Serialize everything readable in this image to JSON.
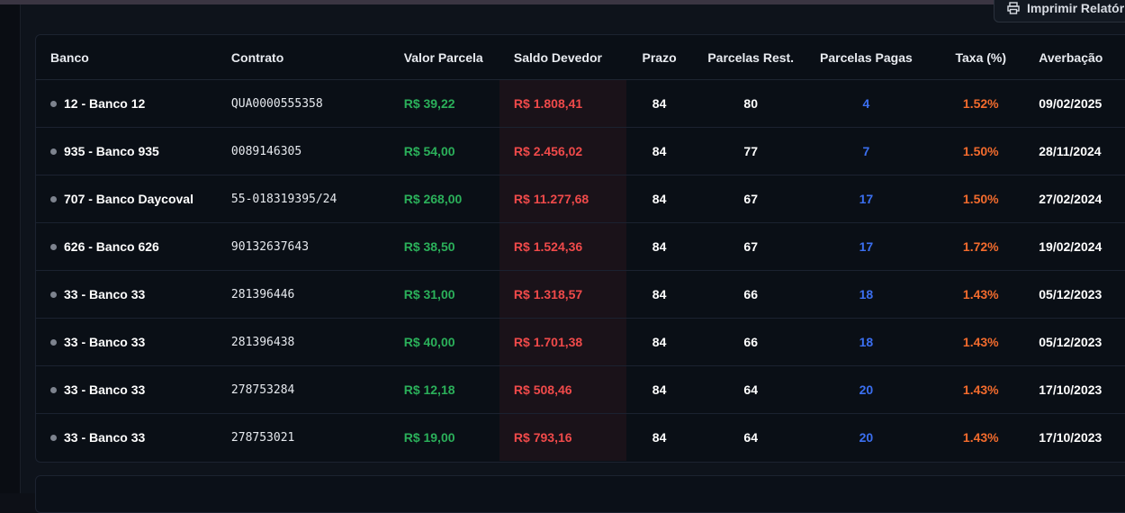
{
  "toolbar": {
    "print_label": "Imprimir Relatório",
    "print_icon": "printer-icon"
  },
  "table": {
    "headers": {
      "banco": "Banco",
      "contrato": "Contrato",
      "valor": "Valor Parcela",
      "saldo": "Saldo Devedor",
      "prazo": "Prazo",
      "rest": "Parcelas Rest.",
      "pagas": "Parcelas Pagas",
      "taxa": "Taxa (%)",
      "aver": "Averbação"
    },
    "rows": [
      {
        "banco": "12 - Banco 12",
        "contrato": "QUA0000555358",
        "valor": "R$ 39,22",
        "saldo": "R$ 1.808,41",
        "prazo": "84",
        "rest": "80",
        "pagas": "4",
        "taxa": "1.52%",
        "aver": "09/02/2025"
      },
      {
        "banco": "935 - Banco 935",
        "contrato": "0089146305",
        "valor": "R$ 54,00",
        "saldo": "R$ 2.456,02",
        "prazo": "84",
        "rest": "77",
        "pagas": "7",
        "taxa": "1.50%",
        "aver": "28/11/2024"
      },
      {
        "banco": "707 - Banco Daycoval",
        "contrato": "55-018319395/24",
        "valor": "R$ 268,00",
        "saldo": "R$ 11.277,68",
        "prazo": "84",
        "rest": "67",
        "pagas": "17",
        "taxa": "1.50%",
        "aver": "27/02/2024"
      },
      {
        "banco": "626 - Banco 626",
        "contrato": "90132637643",
        "valor": "R$ 38,50",
        "saldo": "R$ 1.524,36",
        "prazo": "84",
        "rest": "67",
        "pagas": "17",
        "taxa": "1.72%",
        "aver": "19/02/2024"
      },
      {
        "banco": "33 - Banco 33",
        "contrato": "281396446",
        "valor": "R$ 31,00",
        "saldo": "R$ 1.318,57",
        "prazo": "84",
        "rest": "66",
        "pagas": "18",
        "taxa": "1.43%",
        "aver": "05/12/2023"
      },
      {
        "banco": "33 - Banco 33",
        "contrato": "281396438",
        "valor": "R$ 40,00",
        "saldo": "R$ 1.701,38",
        "prazo": "84",
        "rest": "66",
        "pagas": "18",
        "taxa": "1.43%",
        "aver": "05/12/2023"
      },
      {
        "banco": "33 - Banco 33",
        "contrato": "278753284",
        "valor": "R$ 12,18",
        "saldo": "R$ 508,46",
        "prazo": "84",
        "rest": "64",
        "pagas": "20",
        "taxa": "1.43%",
        "aver": "17/10/2023"
      },
      {
        "banco": "33 - Banco 33",
        "contrato": "278753021",
        "valor": "R$ 19,00",
        "saldo": "R$ 793,16",
        "prazo": "84",
        "rest": "64",
        "pagas": "20",
        "taxa": "1.43%",
        "aver": "17/10/2023"
      }
    ]
  },
  "colors": {
    "valor": "#2bb05a",
    "saldo": "#f04a4a",
    "pagas": "#3b6ff0",
    "taxa": "#f26b2d"
  }
}
